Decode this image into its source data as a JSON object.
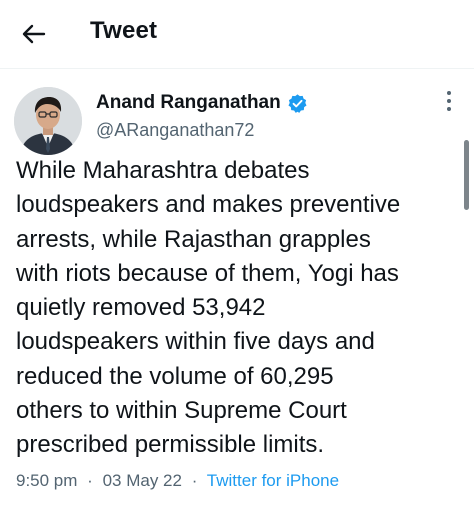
{
  "header": {
    "title": "Tweet",
    "back_icon": "arrow-left-icon"
  },
  "author": {
    "name": "Anand Ranganathan",
    "handle": "@ARanganathan72",
    "verified_icon": "verified-badge-icon",
    "verified_color": "#1d9bf0"
  },
  "tweet": {
    "text": "While Maharashtra debates\nloudspeakers and makes preventive\narrests, while Rajasthan grapples\nwith riots because of them, Yogi has\nquietly removed 53,942\nloudspeakers within five days and\nreduced the volume of 60,295\nothers to within Supreme Court\nprescribed permissible limits.",
    "time": "9:50 pm",
    "separator": "·",
    "date": "03 May 22",
    "source": "Twitter for iPhone"
  },
  "colors": {
    "text": "#0f1419",
    "secondary": "#536471",
    "link": "#1d9bf0"
  }
}
